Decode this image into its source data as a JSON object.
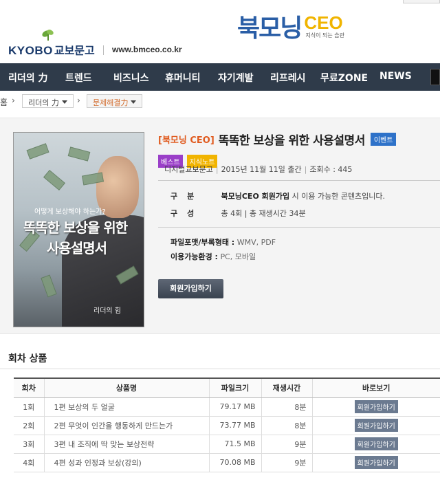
{
  "header": {
    "kyobo_word": "KYOBO",
    "kyobo_korean": "교보문고",
    "site_url": "www.bmceo.co.kr",
    "brand_korean": "북모닝",
    "brand_ceo": "CEO",
    "brand_tagline": "지식이 되는 습관"
  },
  "nav": {
    "items": [
      "리더의 力",
      "트렌드",
      "비즈니스",
      "휴머니티",
      "자기계발",
      "리프레시",
      "무료ZONE",
      "NEWS"
    ]
  },
  "breadcrumb": {
    "home": "홈",
    "sep": "›",
    "level1": "리더의 力",
    "level2": "문제해결力"
  },
  "product": {
    "cover": {
      "subtitle": "어떻게 보상해야 하는가?",
      "title_line1": "똑똑한 보상을 위한",
      "title_line2": "사용설명서",
      "author": "리더의 힘"
    },
    "tag": "[북모닝 CEO]",
    "title": "똑똑한 보상을 위한 사용설명서",
    "event_badge": "이벤트",
    "badges": [
      "베스트",
      "지식노트"
    ],
    "meta": {
      "publisher": "디지털교보문고",
      "date": "2015년 11월 11일 출간",
      "views": "조회수 : 445"
    },
    "specs": [
      {
        "key": "구분",
        "value_bold": "북모닝CEO 회원가입",
        "value": "시 이용 가능한 콘텐츠입니다."
      },
      {
        "key": "구성",
        "value_bold": "",
        "value": "총 4회 | 총 재생시간 34분"
      }
    ],
    "format_key": "파일포맷/부록형태 :",
    "format_val": "WMV, PDF",
    "env_key": "이용가능환경 :",
    "env_val": "PC, 모바일",
    "join_button": "회원가입하기"
  },
  "episodes": {
    "section_title": "회차 상품",
    "headers": [
      "회차",
      "상품명",
      "파일크기",
      "재생시간",
      "바로보기"
    ],
    "rows": [
      {
        "no": "1회",
        "name": "1편 보상의 두 얼굴",
        "size": "79.17 MB",
        "time": "8분",
        "action": "회원가입하기"
      },
      {
        "no": "2회",
        "name": "2편 무엇이 인간을 행동하게 만드는가",
        "size": "73.77 MB",
        "time": "8분",
        "action": "회원가입하기"
      },
      {
        "no": "3회",
        "name": "3편 내 조직에 딱 맞는 보상전략",
        "size": "71.5 MB",
        "time": "9분",
        "action": "회원가입하기"
      },
      {
        "no": "4회",
        "name": "4편 성과 인정과 보상(강의)",
        "size": "70.08 MB",
        "time": "9분",
        "action": "회원가입하기"
      }
    ]
  },
  "colors": {
    "nav_bg": "#2f3b4a",
    "brand_blue": "#2a5ea6",
    "brand_gold": "#f0b400",
    "tag_orange": "#e05a1e",
    "event_blue": "#2e72c9",
    "best_purple": "#9a3fc8"
  }
}
